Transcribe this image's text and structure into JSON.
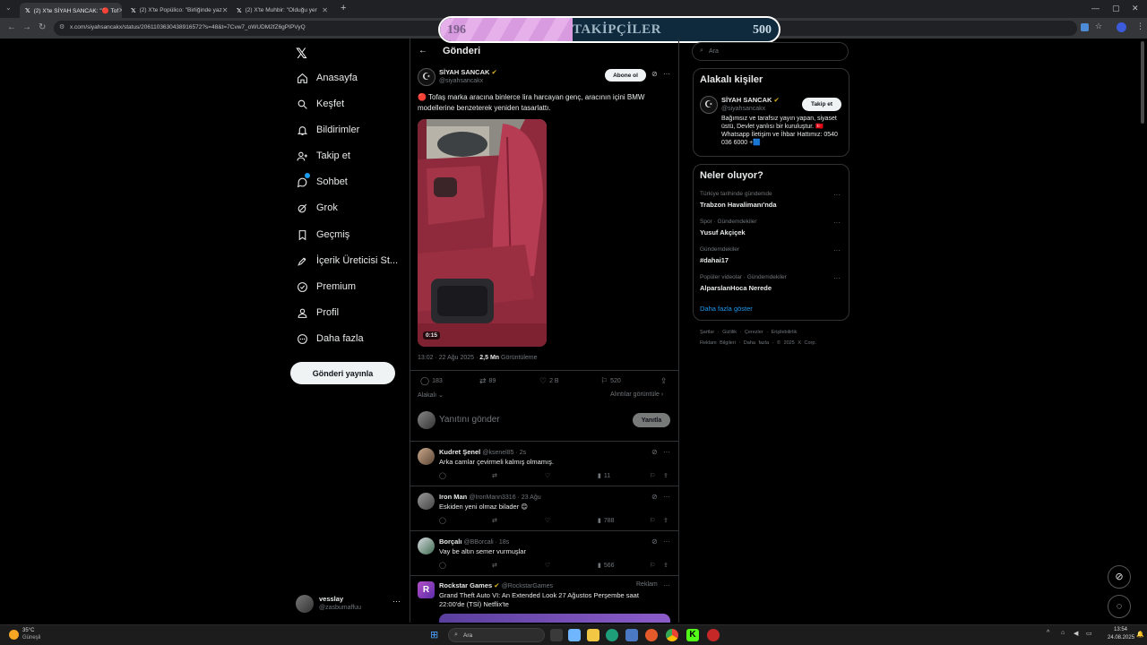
{
  "browser": {
    "tabs": [
      {
        "title": "(2) X'te SİYAH SANCAK: \"🔴 Tof"
      },
      {
        "title": "(2) X'te Popülico: \"Birliğinde yaz"
      },
      {
        "title": "(2) X'te Muhbir: \"Olduğu yer"
      }
    ],
    "url": "x.com/siyahsancakx/status/2061103630438916572?s=48&t=7Cvw7_oWUDM2fZ6gPIPVyQ"
  },
  "overlay": {
    "current": "196",
    "label": "TAKİPÇİLER",
    "max": "500",
    "progress": 0.392
  },
  "nav": {
    "items": [
      {
        "label": "Anasayfa",
        "icon": "home-icon"
      },
      {
        "label": "Keşfet",
        "icon": "search-icon"
      },
      {
        "label": "Bildirimler",
        "icon": "bell-icon"
      },
      {
        "label": "Takip et",
        "icon": "follow-icon"
      },
      {
        "label": "Sohbet",
        "icon": "chat-icon"
      },
      {
        "label": "Grok",
        "icon": "grok-icon"
      },
      {
        "label": "Geçmiş",
        "icon": "bookmark-icon"
      },
      {
        "label": "İçerik Üreticisi St...",
        "icon": "rocket-icon"
      },
      {
        "label": "Premium",
        "icon": "premium-icon"
      },
      {
        "label": "Profil",
        "icon": "person-icon"
      },
      {
        "label": "Daha fazla",
        "icon": "more-circle-icon"
      }
    ],
    "post_button": "Gönderi yayınla",
    "account": {
      "name": "vesslay",
      "handle": "@zasbumaffuu"
    }
  },
  "header": {
    "title": "Gönderi"
  },
  "post": {
    "author": "SİYAH SANCAK",
    "handle": "@siyahsancakx",
    "subscribe": "Abone ol",
    "text": "🔴 Tofaş marka aracına binlerce lira harcayan genç, aracının içini BMW modellerine benzeterek yeniden tasarlattı.",
    "video_time": "0:15",
    "time": "13:02 · 22 Ağu 2025 · ",
    "views": "2,5 Mn",
    "views_label": " Görüntüleme",
    "replies": "183",
    "reposts": "89",
    "likes": "2 B",
    "bookmarks": "520",
    "relevant": "Alakalı",
    "quotes": "Alıntılar görüntüle",
    "reply_placeholder": "Yanıtını gönder",
    "reply_btn": "Yanıtla"
  },
  "replies": [
    {
      "name": "Kudret Şenel",
      "handle": "@ksenel85 · 2s",
      "text": "Arka camlar çevirmeli kalmış olmamış.",
      "views": "11"
    },
    {
      "name": "Iron Man",
      "handle": "@IronMann3316 · 23 Ağu",
      "text": "Eskiden yeni olmaz bilader 😊",
      "views": "788"
    },
    {
      "name": "Borçalı",
      "handle": "@BBorcali · 18s",
      "text": "Vay be altın semer vurmuşlar",
      "views": "566"
    }
  ],
  "ad": {
    "name": "Rockstar Games",
    "handle": "@RockstarGames",
    "tag": "Reklam",
    "text": "Grand Theft Auto VI: An Extended Look 27 Ağustos Perşembe saat 22:00'de (TSİ) Netflix'te"
  },
  "right": {
    "search_placeholder": "Ara",
    "related_title": "Alakalı kişiler",
    "person": {
      "name": "SİYAH SANCAK",
      "handle": "@siyahsancakx",
      "follow": "Takip et",
      "bio": "Bağımsız ve tarafsız yayın yapan, siyaset üstü, Devlet yanlısı bir kuruluştur. 🇹🇷 Whatsapp İletişim ve İhbar Hattımız: 0540 036 6000 +🟦"
    },
    "trends_title": "Neler oluyor?",
    "trends": [
      {
        "cat": "Türkiye tarihinde gündemde",
        "name": "Trabzon Havalimanı'nda"
      },
      {
        "cat": "Spor · Gündemdekiler",
        "name": "Yusuf Akçiçek"
      },
      {
        "cat": "Gündemdekiler",
        "name": "#dahai17"
      },
      {
        "cat": "Popüler videolar · Gündemdekiler",
        "name": "AlparslanHoca Nerede"
      }
    ],
    "show_more": "Daha fazla göster",
    "footer1": [
      "Şartlar",
      "Gizlilik",
      "Çerezler",
      "Erişilebilirlik"
    ],
    "footer2": [
      "Reklam Bilgileri",
      "Daha fazla",
      "© 2025 X Corp."
    ]
  },
  "taskbar": {
    "weather_temp": "35°C",
    "weather_desc": "Güneşli",
    "search": "Ara",
    "time": "13:54",
    "date": "24.08.2025"
  },
  "colors": {
    "accent": "#1d9bf0",
    "bg": "#000000",
    "border": "#2f3336",
    "overlay_fill": "#e6b0ea"
  }
}
